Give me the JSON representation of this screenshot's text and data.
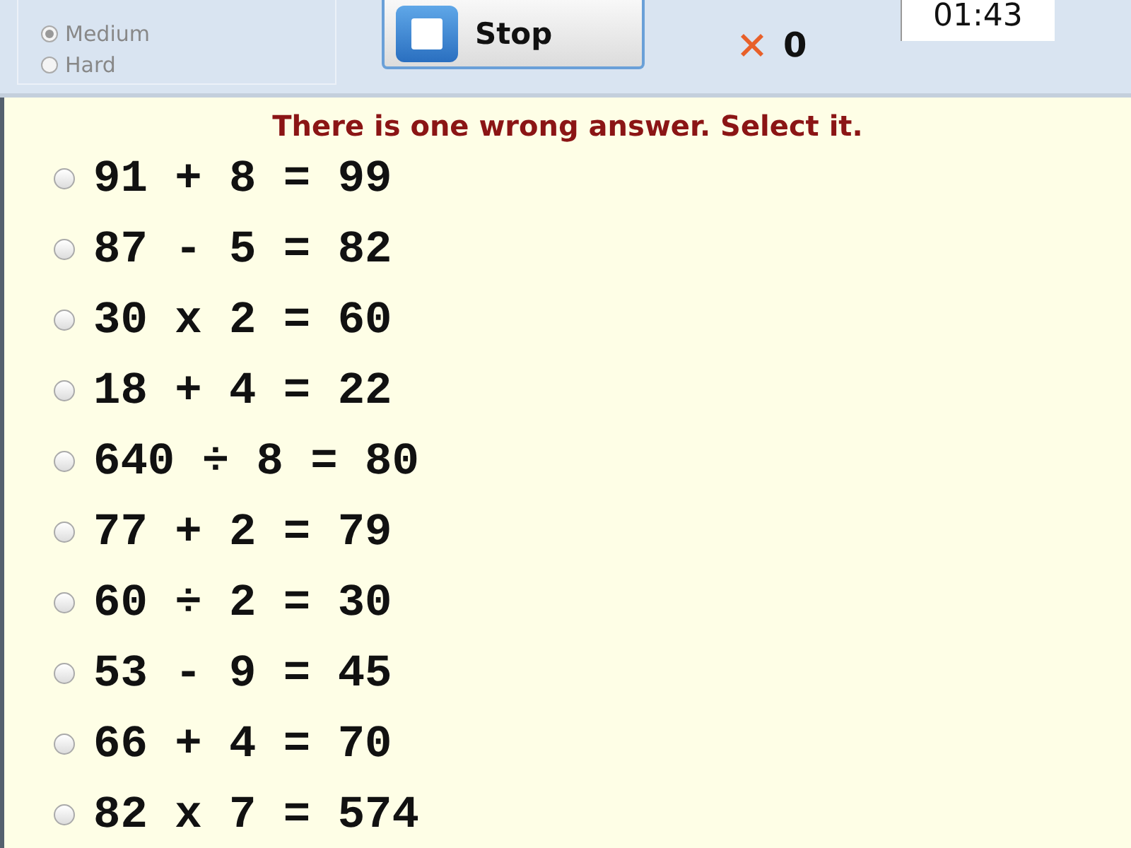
{
  "difficulty": {
    "options": [
      {
        "label": "Medium",
        "selected": true
      },
      {
        "label": "Hard",
        "selected": false
      }
    ]
  },
  "stop_button": {
    "label": "Stop"
  },
  "score": {
    "wrong": "0"
  },
  "timer": "01:43",
  "instruction": "There is one wrong answer. Select it.",
  "answers": [
    {
      "text": "91 + 8 = 99",
      "selected": false
    },
    {
      "text": "87 - 5 = 82",
      "selected": false
    },
    {
      "text": "30 x 2 = 60",
      "selected": false
    },
    {
      "text": "18 + 4 = 22",
      "selected": false
    },
    {
      "text": "640 ÷ 8 = 80",
      "selected": false
    },
    {
      "text": "77 + 2 = 79",
      "selected": false
    },
    {
      "text": "60 ÷ 2 = 30",
      "selected": false
    },
    {
      "text": "53 - 9 = 45",
      "selected": false
    },
    {
      "text": "66 + 4 = 70",
      "selected": false
    },
    {
      "text": "82 x 7 = 574",
      "selected": false
    }
  ]
}
